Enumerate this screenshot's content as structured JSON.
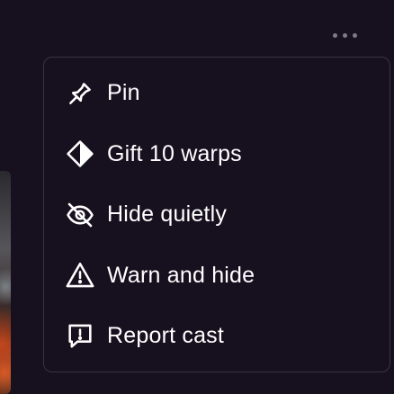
{
  "more_button": {
    "icon": "more-horizontal-icon"
  },
  "menu": {
    "items": [
      {
        "label": "Pin",
        "icon": "pin-icon"
      },
      {
        "label": "Gift 10 warps",
        "icon": "warp-diamond-icon"
      },
      {
        "label": "Hide quietly",
        "icon": "eye-off-icon"
      },
      {
        "label": "Warn and hide",
        "icon": "warning-triangle-icon"
      },
      {
        "label": "Report cast",
        "icon": "report-message-icon"
      }
    ]
  },
  "colors": {
    "background": "#17101f",
    "menu_border": "#3a3343",
    "text": "#ffffff",
    "dots": "#7e7a88"
  }
}
